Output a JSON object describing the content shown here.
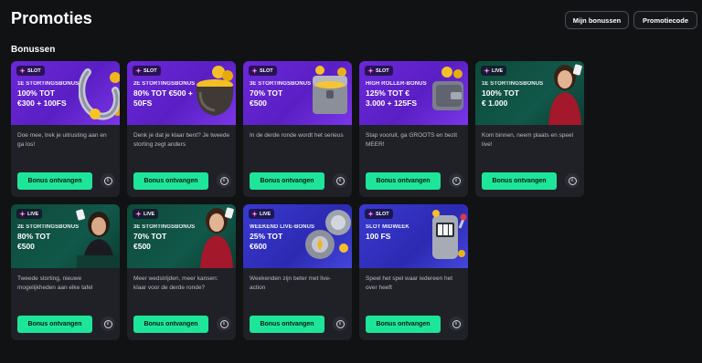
{
  "header": {
    "title": "Promoties",
    "my_bonuses_label": "Mijn bonussen",
    "promo_code_label": "Promotiecode"
  },
  "section": {
    "title": "Bonussen"
  },
  "claim_label": "Bonus ontvangen",
  "info_glyph": "i",
  "colors": {
    "accent": "#1de59a",
    "purple": "#6b28d9",
    "green": "#0e4a3a",
    "blue": "#3a3ad0",
    "card_bg": "#1f2127"
  },
  "cards": [
    {
      "badge": "SLOT",
      "subtitle": "1E STORTINGSBONUS",
      "line1": "100% TOT",
      "line2": "€300 + 100FS",
      "description": "Doe mee, trek je uitrusting aan en ga los!",
      "theme": "purple",
      "art": "horseshoe-icon"
    },
    {
      "badge": "SLOT",
      "subtitle": "2E STORTINGSBONUS",
      "line1": "80% TOT €500 +",
      "line2": "50FS",
      "description": "Denk je dat je klaar bent? Je tweede storting zegt anders",
      "theme": "purple",
      "art": "pot-of-gold-icon"
    },
    {
      "badge": "SLOT",
      "subtitle": "3E STORTINGSBONUS",
      "line1": "70% TOT",
      "line2": "€500",
      "description": "In de derde ronde wordt het serieus",
      "theme": "purple",
      "art": "treasure-chest-icon"
    },
    {
      "badge": "SLOT",
      "subtitle": "HIGH ROLLER-BONUS",
      "line1": "125% TOT €",
      "line2": "3.000 + 125FS",
      "description": "Stap vooruit, ga GROOTS en bezit MEER!",
      "theme": "purple",
      "art": "wallet-icon"
    },
    {
      "badge": "LIVE",
      "subtitle": "1E STORTINGSBONUS",
      "line1": "100% TOT",
      "line2": "€ 1.000",
      "description": "Kom binnen, neem plaats en speel live!",
      "theme": "green",
      "art": "dealer-icon"
    },
    {
      "badge": "LIVE",
      "subtitle": "2E STORTINGSBONUS",
      "line1": "80% TOT",
      "line2": "€500",
      "description": "Tweede storting, nieuwe mogelijkheden aan elke tafel",
      "theme": "green",
      "art": "dealer-cards-icon"
    },
    {
      "badge": "LIVE",
      "subtitle": "3E STORTINGSBONUS",
      "line1": "70% TOT",
      "line2": "€500",
      "description": "Meer wedstrijden, meer kansen: klaar voor de derde ronde?",
      "theme": "green",
      "art": "dealer-icon"
    },
    {
      "badge": "LIVE",
      "subtitle": "WEEKEND LIVE-BONUS",
      "line1": "25% TOT",
      "line2": "€600",
      "description": "Weekenden zijn beter met live-action",
      "theme": "blue",
      "art": "chips-icon"
    },
    {
      "badge": "SLOT",
      "subtitle": "SLOT MIDWEEK",
      "line1": "100 FS",
      "line2": "",
      "description": "Speel het spel waar iedereen het over heeft",
      "theme": "blue",
      "art": "slot-machine-icon"
    }
  ]
}
